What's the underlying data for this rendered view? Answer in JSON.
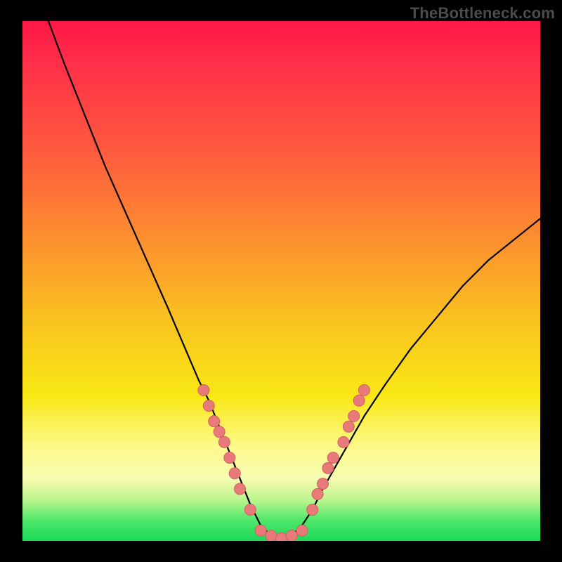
{
  "watermark": "TheBottleneck.com",
  "colors": {
    "frame_bg": "#000000",
    "watermark": "#4c4c4c",
    "curve": "#000000",
    "marker_fill": "#e97a7a",
    "marker_stroke": "#d46060",
    "gradient_stops": [
      "#ff1744",
      "#fd8f2f",
      "#f9e814",
      "#1cd958"
    ]
  },
  "chart_data": {
    "type": "line",
    "title": "",
    "xlabel": "",
    "ylabel": "",
    "xlim": [
      0,
      100
    ],
    "ylim": [
      0,
      100
    ],
    "grid": false,
    "legend": null,
    "series": [
      {
        "name": "bottleneck-curve",
        "x": [
          5,
          8,
          12,
          16,
          20,
          24,
          28,
          31,
          34,
          36,
          38,
          40,
          42,
          44,
          46,
          48,
          50,
          52,
          54,
          56,
          58,
          62,
          66,
          70,
          75,
          80,
          85,
          90,
          95,
          100
        ],
        "y": [
          100,
          92,
          82,
          72,
          63,
          54,
          45,
          38,
          31,
          27,
          22,
          17,
          12,
          7,
          3,
          1,
          0,
          1,
          3,
          6,
          10,
          17,
          24,
          30,
          37,
          43,
          49,
          54,
          58,
          62
        ]
      }
    ],
    "markers": [
      {
        "name": "left-cluster",
        "x": 35,
        "y": 29
      },
      {
        "name": "left-cluster",
        "x": 36,
        "y": 26
      },
      {
        "name": "left-cluster",
        "x": 37,
        "y": 23
      },
      {
        "name": "left-cluster",
        "x": 38,
        "y": 21
      },
      {
        "name": "left-cluster",
        "x": 39,
        "y": 19
      },
      {
        "name": "left-cluster",
        "x": 40,
        "y": 16
      },
      {
        "name": "left-cluster",
        "x": 41,
        "y": 13
      },
      {
        "name": "left-cluster",
        "x": 42,
        "y": 10
      },
      {
        "name": "left-cluster",
        "x": 44,
        "y": 6
      },
      {
        "name": "bottom-flat",
        "x": 46,
        "y": 2
      },
      {
        "name": "bottom-flat",
        "x": 48,
        "y": 1
      },
      {
        "name": "bottom-flat",
        "x": 50,
        "y": 0.5
      },
      {
        "name": "bottom-flat",
        "x": 52,
        "y": 1
      },
      {
        "name": "bottom-flat",
        "x": 54,
        "y": 2
      },
      {
        "name": "right-cluster",
        "x": 56,
        "y": 6
      },
      {
        "name": "right-cluster",
        "x": 57,
        "y": 9
      },
      {
        "name": "right-cluster",
        "x": 58,
        "y": 11
      },
      {
        "name": "right-cluster",
        "x": 59,
        "y": 14
      },
      {
        "name": "right-cluster",
        "x": 60,
        "y": 16
      },
      {
        "name": "right-cluster",
        "x": 62,
        "y": 19
      },
      {
        "name": "right-cluster",
        "x": 63,
        "y": 22
      },
      {
        "name": "right-cluster",
        "x": 64,
        "y": 24
      },
      {
        "name": "right-cluster",
        "x": 65,
        "y": 27
      },
      {
        "name": "right-cluster",
        "x": 66,
        "y": 29
      }
    ]
  }
}
